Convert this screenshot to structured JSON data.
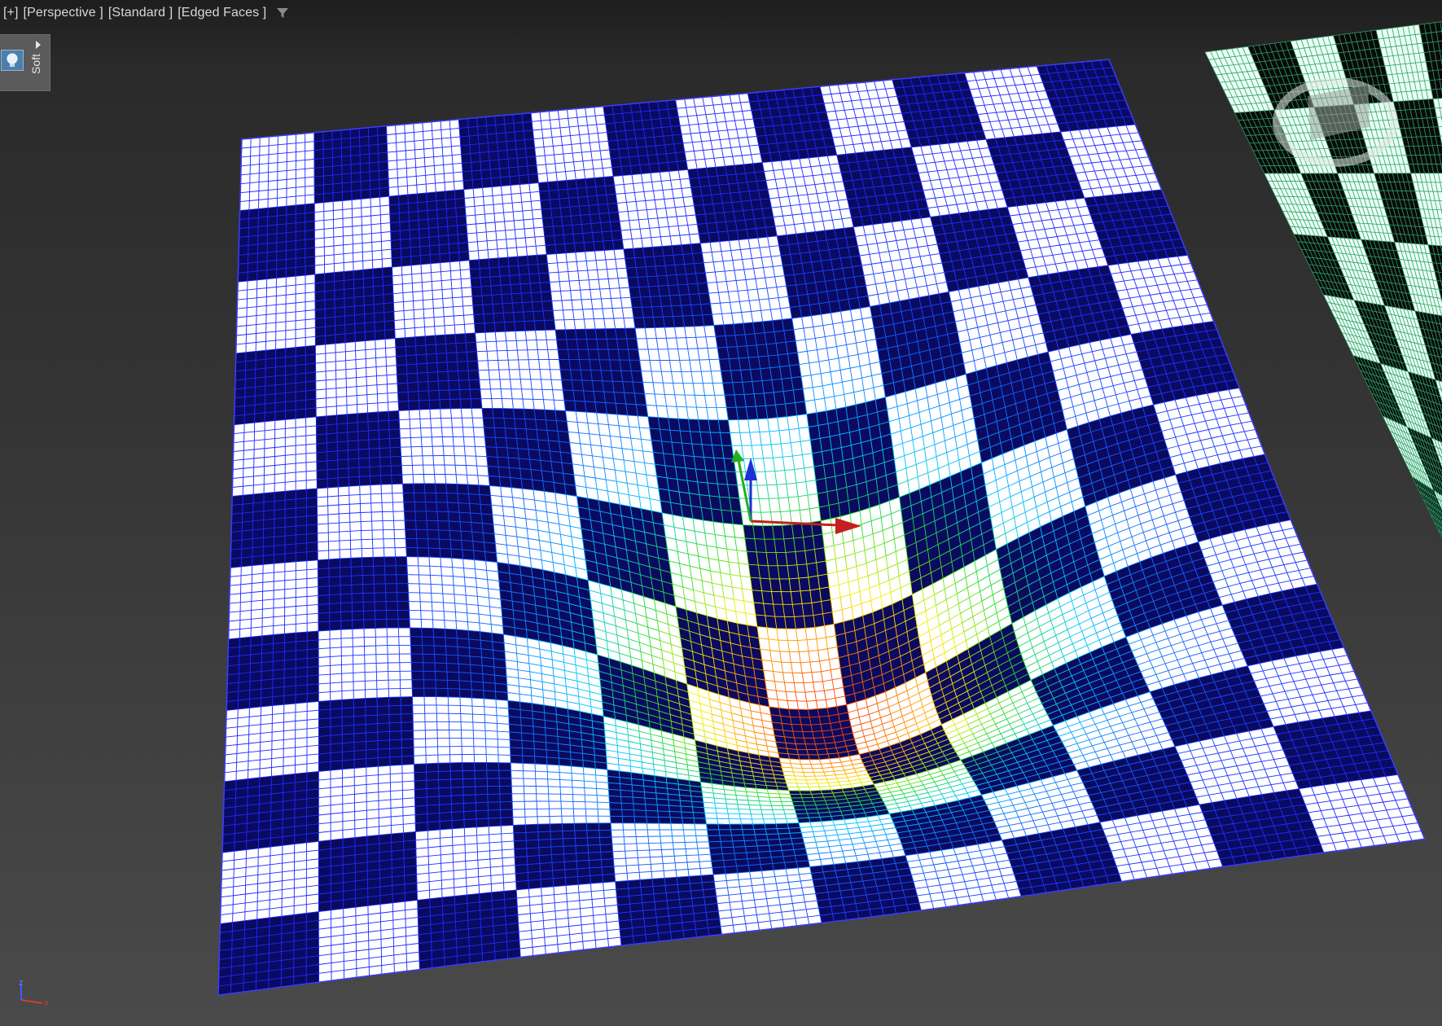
{
  "viewport": {
    "labels": {
      "plus": "[+]",
      "view": "[Perspective ]",
      "shading": "[Standard ]",
      "display_mode": "[Edged Faces ]"
    },
    "filter_icon": "funnel-filter-icon"
  },
  "side_panel": {
    "label": "Soft",
    "icon": "light-bulb-icon",
    "expand_icon": "triangle-right-icon"
  },
  "scene": {
    "main_plane": {
      "pattern": "checkerboard",
      "wire_color": "#3b3bff",
      "light_square": "#ffffff",
      "dark_square": "#0a0a60",
      "effect": "soft-selection falloff funnel (red center to blue edge)"
    },
    "secondary_plane": {
      "pattern": "checkerboard",
      "wire_color": "#2e9e6a",
      "light_square": "#e9fff2",
      "dark_square": "#0a0a0a"
    },
    "gizmo": [
      "x-axis-red",
      "y-axis-green",
      "z-axis-blue"
    ],
    "navigation": "viewcube"
  },
  "axis_tripod": {
    "x": "x",
    "z": "z"
  }
}
